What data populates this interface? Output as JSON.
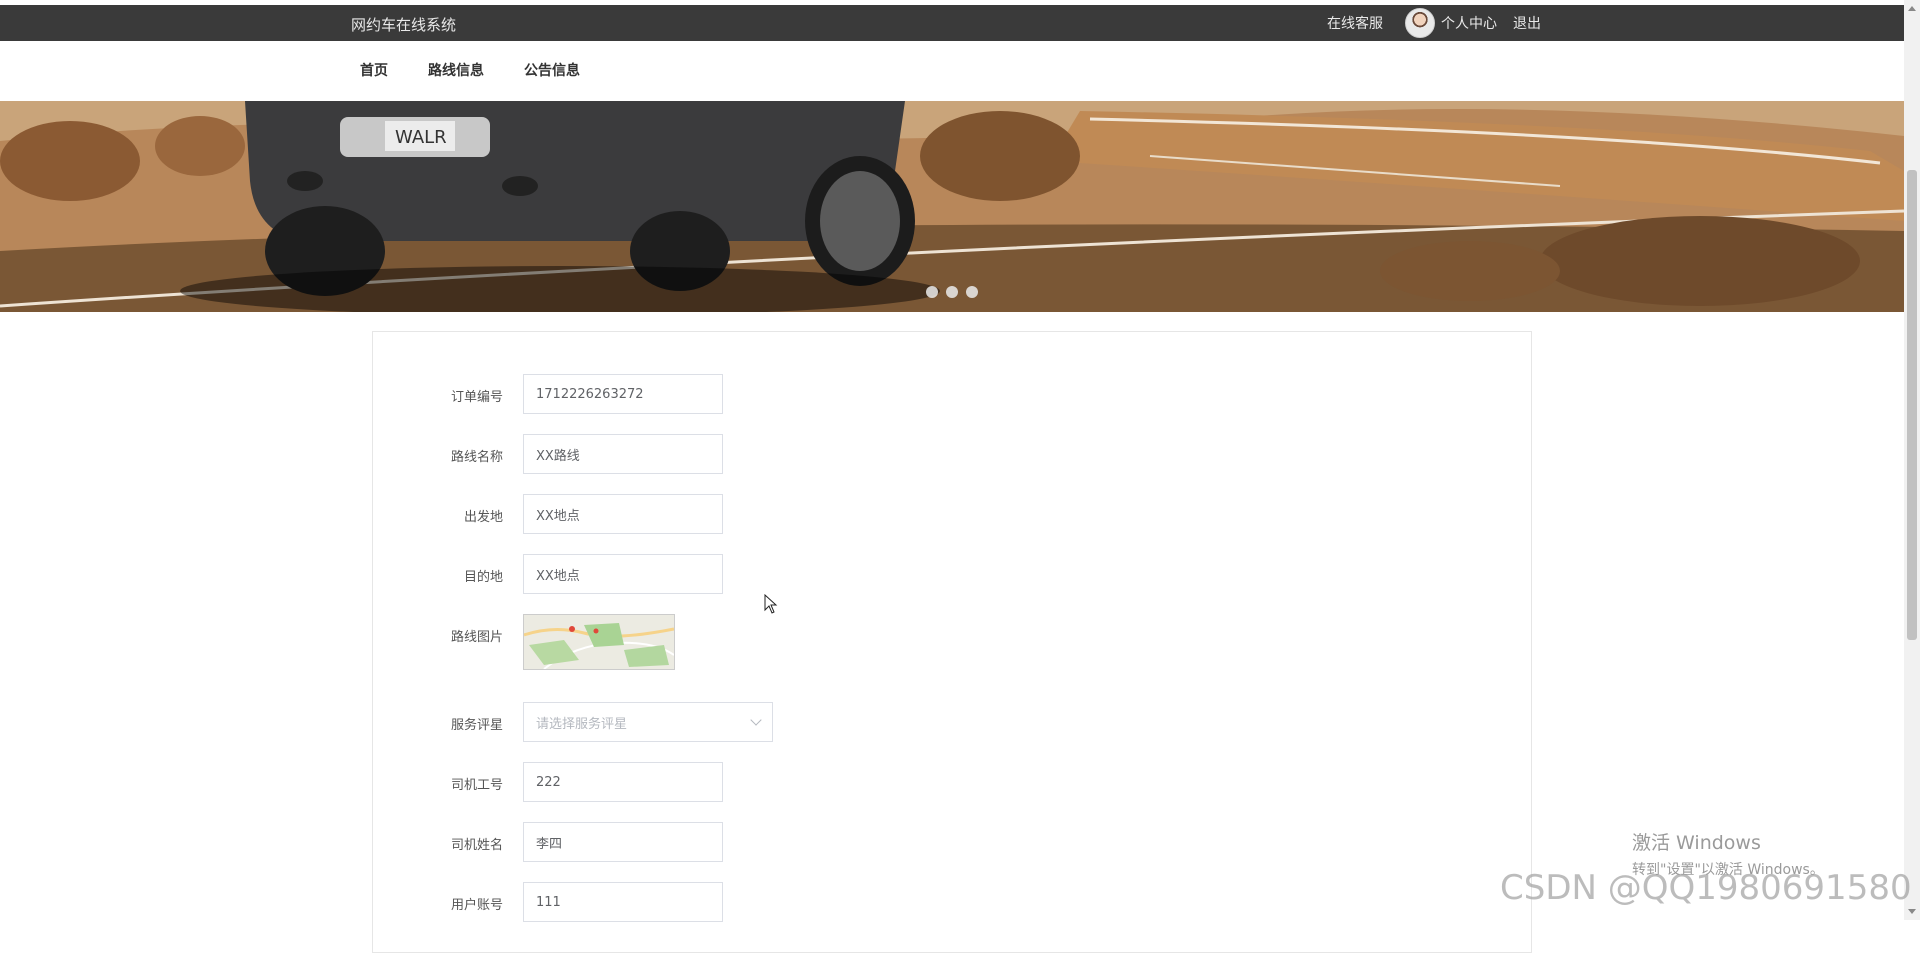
{
  "header": {
    "app_title": "网约车在线系统",
    "service_link": "在线客服",
    "profile_link": "个人中心",
    "logout_link": "退出"
  },
  "nav": {
    "items": [
      "首页",
      "路线信息",
      "公告信息"
    ]
  },
  "banner": {
    "slide_count": 3
  },
  "form": {
    "order_no": {
      "label": "订单编号",
      "value": "1712226263272"
    },
    "route_name": {
      "label": "路线名称",
      "value": "XX路线"
    },
    "departure": {
      "label": "出发地",
      "value": "XX地点"
    },
    "destination": {
      "label": "目的地",
      "value": "XX地点"
    },
    "route_image": {
      "label": "路线图片"
    },
    "service_rating": {
      "label": "服务评星",
      "placeholder": "请选择服务评星"
    },
    "driver_id": {
      "label": "司机工号",
      "value": "222"
    },
    "driver_name": {
      "label": "司机姓名",
      "value": "李四"
    },
    "user_account": {
      "label": "用户账号",
      "value": "111"
    }
  },
  "watermark": {
    "activate_title": "激活 Windows",
    "activate_sub": "转到\"设置\"以激活 Windows。",
    "csdn": "CSDN @QQ1980691580"
  },
  "colors": {
    "topbar": "#3a3a3a",
    "input_border": "#dcdfe6"
  }
}
